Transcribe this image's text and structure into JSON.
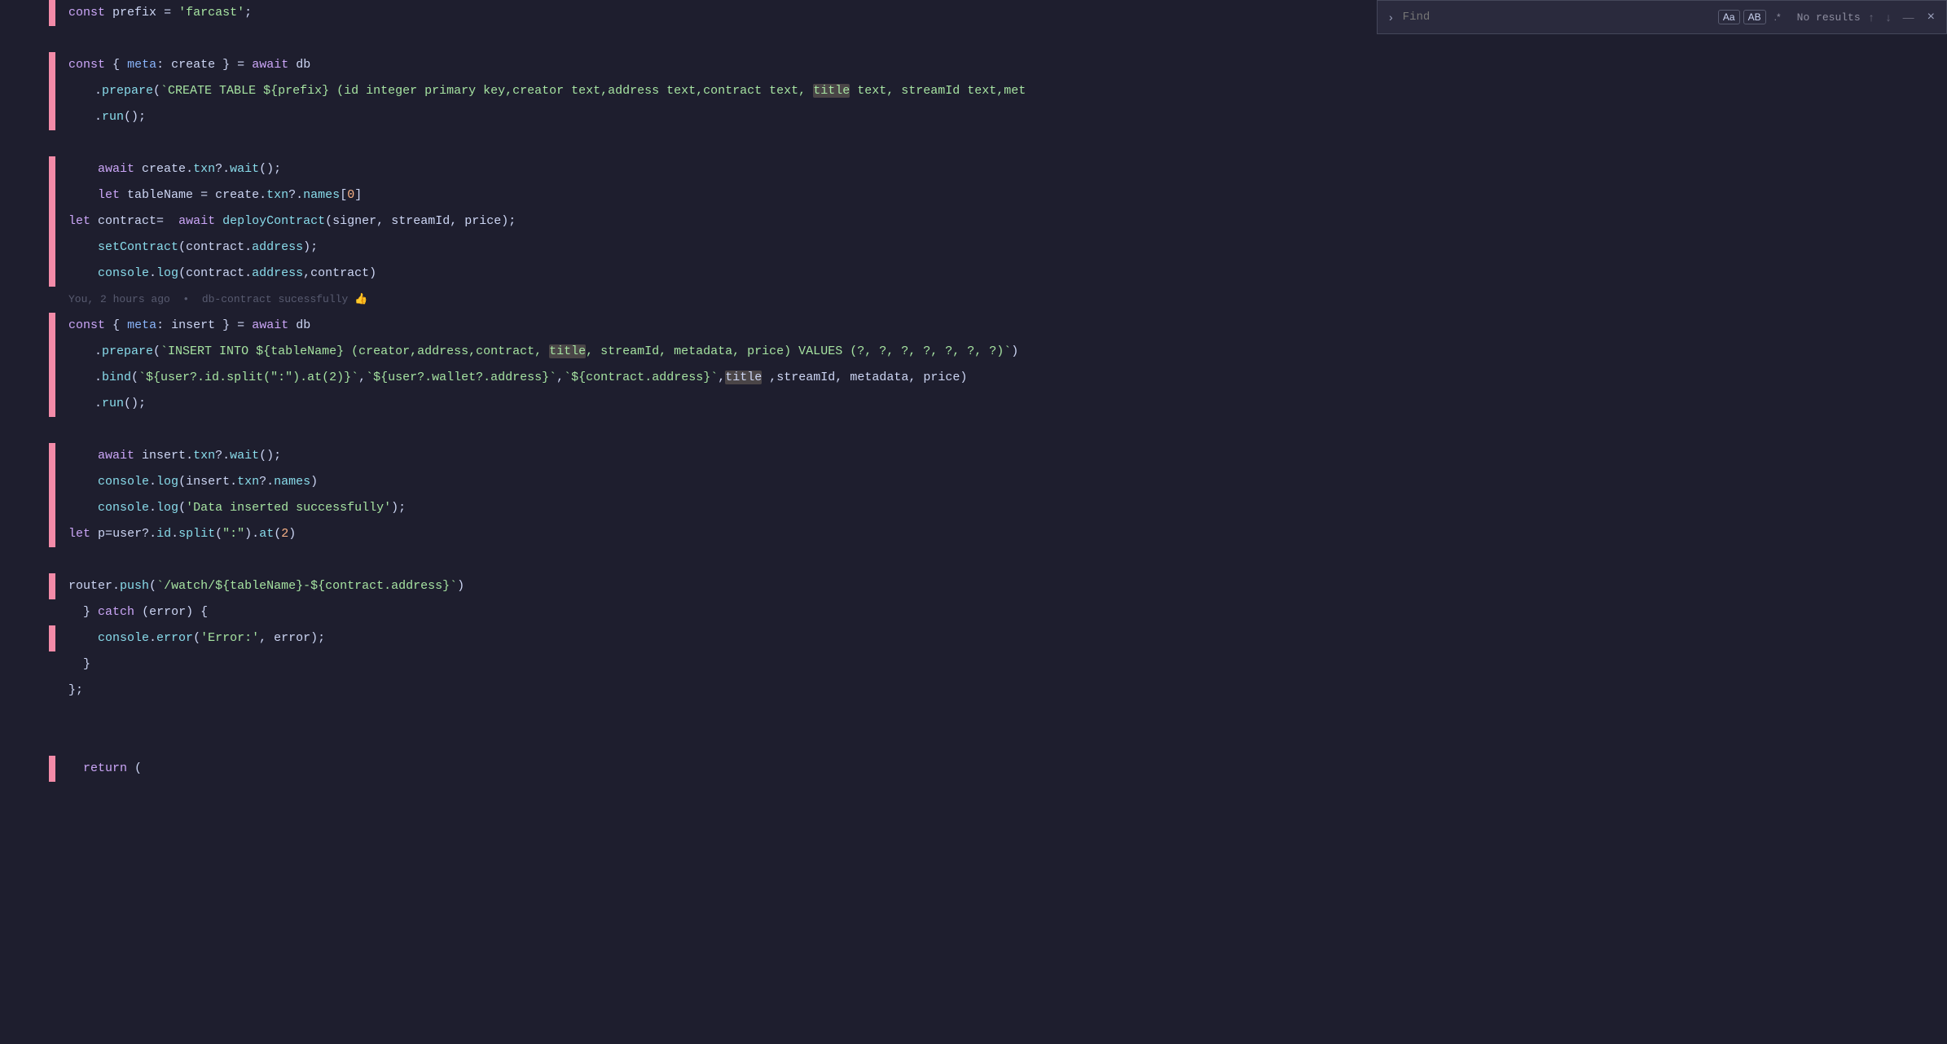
{
  "editor": {
    "lines": [
      {
        "id": 1,
        "gutter": "",
        "diff": "red",
        "content_html": "<span class='kw'>const</span> <span class='var-name'>prefix</span> <span class='punct'>=</span> <span class='str'>'farcast'</span><span class='punct'>;</span>",
        "indent": 0
      },
      {
        "id": 2,
        "gutter": "",
        "diff": "",
        "content_html": "",
        "indent": 0,
        "empty": true
      },
      {
        "id": 3,
        "gutter": "",
        "diff": "red",
        "content_html": "<span class='kw'>const</span> <span class='punct'>{</span> <span class='kw-blue'>meta</span><span class='punct'>:</span> <span class='var-name'>create</span> <span class='punct'>}</span> <span class='punct'>=</span> <span class='kw'>await</span> <span class='var-name'>db</span>",
        "indent": 0
      },
      {
        "id": 4,
        "gutter": "",
        "diff": "red",
        "content_html": "<span class='punct'>.</span><span class='fn'>prepare</span><span class='punct'>(`CREATE TABLE <span class='str-tmpl'>${prefix}</span> (id integer primary key,creator text,address text,contract text, <span class='highlight-word'>title</span> text, streamId text,met</span>",
        "indent": 1
      },
      {
        "id": 5,
        "gutter": "",
        "diff": "red",
        "content_html": "<span class='punct'>.</span><span class='fn'>run</span><span class='punct'>();</span>",
        "indent": 1
      },
      {
        "id": 6,
        "gutter": "",
        "diff": "",
        "content_html": "",
        "indent": 0,
        "empty": true
      },
      {
        "id": 7,
        "gutter": "",
        "diff": "red",
        "content_html": "<span class='kw'>    await</span> <span class='var-name'>create</span><span class='punct'>.</span><span class='prop'>txn</span><span class='punct'>?.</span><span class='fn'>wait</span><span class='punct'>();</span>",
        "indent": 0
      },
      {
        "id": 8,
        "gutter": "",
        "diff": "red",
        "content_html": "<span class='kw'>    let</span> <span class='var-name'>tableName</span> <span class='punct'>=</span> <span class='var-name'>create</span><span class='punct'>.</span><span class='prop'>txn</span><span class='punct'>?.</span><span class='prop'>names</span><span class='punct'>[</span><span class='num'>0</span><span class='punct'>]</span>",
        "indent": 0
      },
      {
        "id": 9,
        "gutter": "",
        "diff": "red",
        "content_html": "<span class='kw'>let</span> <span class='var-name'>contract</span><span class='punct'>=</span>  <span class='kw'>await</span> <span class='fn'>deployContract</span><span class='punct'>(</span><span class='var-name'>signer</span><span class='punct'>,</span> <span class='var-name'>streamId</span><span class='punct'>,</span> <span class='var-name'>price</span><span class='punct'>);</span>",
        "indent": 0
      },
      {
        "id": 10,
        "gutter": "",
        "diff": "red",
        "content_html": "<span class='fn'>    setContract</span><span class='punct'>(</span><span class='var-name'>contract</span><span class='punct'>.</span><span class='prop'>address</span><span class='punct'>);</span>",
        "indent": 0
      },
      {
        "id": 11,
        "gutter": "",
        "diff": "red",
        "content_html": "<span class='fn'>    console</span><span class='punct'>.</span><span class='fn'>log</span><span class='punct'>(</span><span class='var-name'>contract</span><span class='punct'>.</span><span class='prop'>address</span><span class='punct'>,</span><span class='var-name'>contract</span><span class='punct'>)</span>",
        "indent": 0
      },
      {
        "id": 12,
        "gutter": "",
        "diff": "",
        "content_html": "<span class='blame'>You, 2 hours ago  •  db-contract sucessfully </span><span class='blame-emoji'>👍</span>",
        "indent": 0,
        "blame_line": true
      },
      {
        "id": 13,
        "gutter": "",
        "diff": "red",
        "content_html": "<span class='kw'>const</span> <span class='punct'>{</span> <span class='kw-blue'>meta</span><span class='punct'>:</span> <span class='var-name'>insert</span> <span class='punct'>}</span> <span class='punct'>=</span> <span class='kw'>await</span> <span class='var-name'>db</span>",
        "indent": 0
      },
      {
        "id": 14,
        "gutter": "",
        "diff": "red",
        "content_html": "<span class='punct'>.</span><span class='fn'>prepare</span><span class='punct'>(`INSERT INTO <span class='str-tmpl'>${tableName}</span> (creator,address,contract, <span class='highlight-word'>title</span>, streamId, metadata, price) VALUES (?, ?, ?, ?, ?, ?, ?)`)</span>",
        "indent": 1
      },
      {
        "id": 15,
        "gutter": "",
        "diff": "red",
        "content_html": "<span class='punct'>.</span><span class='fn'>bind</span><span class='punct'>(`<span class='str-tmpl'>${user?.id.split(\":\").at(2)}</span>`,`<span class='str-tmpl'>${user?.wallet?.address}</span>`,`<span class='str-tmpl'>${contract.address}</span>`,<span class='highlight-word'>title</span> ,streamId, metadata, price)</span>",
        "indent": 1
      },
      {
        "id": 16,
        "gutter": "",
        "diff": "red",
        "content_html": "<span class='punct'>.</span><span class='fn'>run</span><span class='punct'>();</span>",
        "indent": 1
      },
      {
        "id": 17,
        "gutter": "",
        "diff": "",
        "content_html": "",
        "indent": 0,
        "empty": true
      },
      {
        "id": 18,
        "gutter": "",
        "diff": "red",
        "content_html": "<span class='kw'>    await</span> <span class='var-name'>insert</span><span class='punct'>.</span><span class='prop'>txn</span><span class='punct'>?.</span><span class='fn'>wait</span><span class='punct'>();</span>",
        "indent": 0
      },
      {
        "id": 19,
        "gutter": "",
        "diff": "red",
        "content_html": "<span class='fn'>    console</span><span class='punct'>.</span><span class='fn'>log</span><span class='punct'>(</span><span class='var-name'>insert</span><span class='punct'>.</span><span class='prop'>txn</span><span class='punct'>?.</span><span class='prop'>names</span><span class='punct'>)</span>",
        "indent": 0
      },
      {
        "id": 20,
        "gutter": "",
        "diff": "red",
        "content_html": "<span class='fn'>    console</span><span class='punct'>.</span><span class='fn'>log</span><span class='punct'>(</span><span class='str'>'Data inserted successfully'</span><span class='punct'>);</span>",
        "indent": 0
      },
      {
        "id": 21,
        "gutter": "",
        "diff": "red",
        "content_html": "<span class='kw'>let</span> <span class='var-name'>p</span><span class='punct'>=</span><span class='var-name'>user</span><span class='punct'>?.</span><span class='prop'>id</span><span class='punct'>.</span><span class='fn'>split</span><span class='punct'>(</span><span class='str'>\":\"</span><span class='punct'>).</span><span class='fn'>at</span><span class='punct'>(</span><span class='num'>2</span><span class='punct'>)</span>",
        "indent": 0
      },
      {
        "id": 22,
        "gutter": "",
        "diff": "",
        "content_html": "",
        "indent": 0,
        "empty": true
      },
      {
        "id": 23,
        "gutter": "",
        "diff": "red",
        "content_html": "<span class='var-name'>router</span><span class='punct'>.</span><span class='fn'>push</span><span class='punct'>(`/watch/<span class='str-tmpl'>${tableName}</span>-<span class='str-tmpl'>${contract.address}</span>`)</span>",
        "indent": 0
      },
      {
        "id": 24,
        "gutter": "",
        "diff": "",
        "content_html": "<span class='punct'>  }</span> <span class='kw'>catch</span> <span class='punct'>(</span><span class='var-name'>error</span><span class='punct'>)</span> <span class='punct'>{</span>",
        "indent": 0
      },
      {
        "id": 25,
        "gutter": "",
        "diff": "red",
        "content_html": "<span class='fn'>    console</span><span class='punct'>.</span><span class='fn'>error</span><span class='punct'>(</span><span class='str'>'Error:'</span><span class='punct'>,</span> <span class='var-name'>error</span><span class='punct'>);</span>",
        "indent": 0
      },
      {
        "id": 26,
        "gutter": "",
        "diff": "",
        "content_html": "<span class='punct'>  }</span>",
        "indent": 0
      },
      {
        "id": 27,
        "gutter": "",
        "diff": "",
        "content_html": "<span class='punct'>};</span>",
        "indent": 0
      },
      {
        "id": 28,
        "gutter": "",
        "diff": "",
        "content_html": "",
        "indent": 0,
        "empty": true
      },
      {
        "id": 29,
        "gutter": "",
        "diff": "",
        "content_html": "",
        "indent": 0,
        "empty": true
      },
      {
        "id": 30,
        "gutter": "",
        "diff": "red",
        "content_html": "<span class='kw'>  return</span> <span class='punct'>(</span>",
        "indent": 0
      }
    ]
  },
  "search": {
    "placeholder": "Find",
    "value": "",
    "no_results": "No results",
    "option_aa": "Aa",
    "option_ab": "AB",
    "option_regex": ".*",
    "prev_label": "↑",
    "next_label": "↓",
    "close_label": "×",
    "expand_label": "▼"
  }
}
